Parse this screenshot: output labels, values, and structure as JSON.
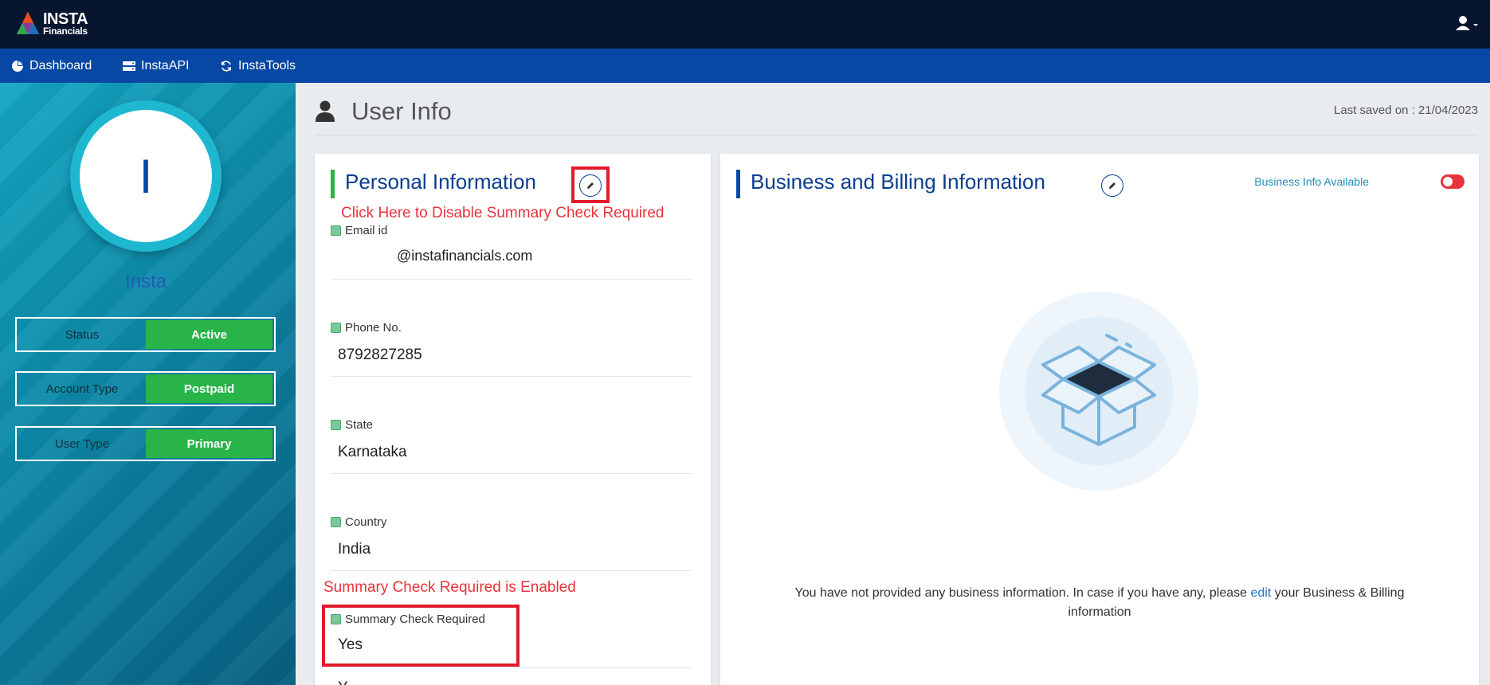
{
  "brand": {
    "line1": "INSTA",
    "line2": "Financials"
  },
  "nav": [
    {
      "label": "Dashboard"
    },
    {
      "label": "InstaAPI"
    },
    {
      "label": "InstaTools"
    }
  ],
  "profile": {
    "initial": "I",
    "name": "Insta",
    "rows": [
      {
        "label": "Status",
        "value": "Active"
      },
      {
        "label": "Account Type",
        "value": "Postpaid"
      },
      {
        "label": "User Type",
        "value": "Primary"
      }
    ]
  },
  "page": {
    "title": "User Info",
    "last_saved": "Last saved on : 21/04/2023"
  },
  "personal": {
    "title": "Personal Information",
    "annotation_top": "Click Here to Disable Summary Check Required",
    "annotation_bottom": "Summary Check Required is Enabled",
    "fields": [
      {
        "label": "Email id",
        "value": "@instafinancials.com"
      },
      {
        "label": "Phone No.",
        "value": "8792827285"
      },
      {
        "label": "State",
        "value": "Karnataka"
      },
      {
        "label": "Country",
        "value": "India"
      },
      {
        "label": "Summary Check Required",
        "value": "Yes"
      }
    ],
    "partial_next": "Y"
  },
  "business": {
    "title": "Business and Billing Information",
    "toggle_label": "Business Info Available",
    "toggle_on": false,
    "empty_pre": "You have not provided any business information. In case if you have any, please",
    "empty_link": "edit",
    "empty_post": "your Business & Billing information"
  },
  "colors": {
    "topbar": "#07152e",
    "navbar": "#0648a3",
    "accent_green": "#28b449",
    "annotation_red": "#e8333c"
  },
  "icons": {
    "dashboard": "pie-chart-icon",
    "api": "server-icon",
    "tools": "refresh-icon",
    "user": "user-icon",
    "edit": "pencil-icon"
  }
}
